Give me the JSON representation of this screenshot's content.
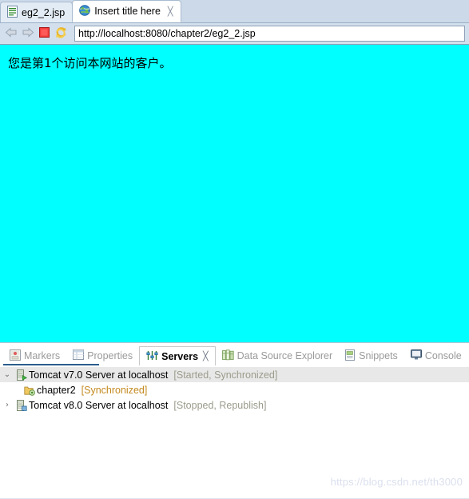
{
  "editor": {
    "tabs": [
      {
        "label": "eg2_2.jsp",
        "icon": "jsp-file-icon",
        "active": false,
        "closable": false
      },
      {
        "label": "Insert title here",
        "icon": "globe-icon",
        "active": true,
        "closable": true,
        "close_glyph": "╳"
      }
    ]
  },
  "toolbar": {
    "back_icon": "back-arrow-icon",
    "forward_icon": "forward-arrow-icon",
    "stop_icon": "stop-icon",
    "refresh_icon": "refresh-icon",
    "url_value": "http://localhost:8080/chapter2/eg2_2.jsp",
    "url_placeholder": "Enter URL"
  },
  "page": {
    "background_color": "#00ffff",
    "text": "您是第1个访问本网站的客户。"
  },
  "views": {
    "tabs": [
      {
        "label": "Markers",
        "icon": "markers-icon",
        "active": false,
        "closable": false
      },
      {
        "label": "Properties",
        "icon": "properties-icon",
        "active": false,
        "closable": false
      },
      {
        "label": "Servers",
        "icon": "servers-icon",
        "active": true,
        "closable": true,
        "close_glyph": "╳"
      },
      {
        "label": "Data Source Explorer",
        "icon": "data-source-explorer-icon",
        "active": false,
        "closable": false
      },
      {
        "label": "Snippets",
        "icon": "snippets-icon",
        "active": false,
        "closable": false
      },
      {
        "label": "Console",
        "icon": "console-icon",
        "active": false,
        "closable": false
      }
    ]
  },
  "servers": {
    "rows": [
      {
        "twisty": "⌄",
        "icon": "server-started-icon",
        "name": "Tomcat v7.0 Server at localhost",
        "state": "[Started, Synchronized]",
        "selected": true,
        "level": 0
      },
      {
        "twisty": "",
        "icon": "module-icon",
        "name": "chapter2",
        "state": "[Synchronized]",
        "selected": false,
        "level": 1
      },
      {
        "twisty": "›",
        "icon": "server-stopped-icon",
        "name": "Tomcat v8.0 Server at localhost",
        "state": "[Stopped, Republish]",
        "selected": false,
        "level": 0
      }
    ]
  },
  "watermark": {
    "text": "https://blog.csdn.net/th3000"
  },
  "colors": {
    "page_background": "#00ffff",
    "tabstrip_background": "#ccd9e8",
    "toolbar_background": "#d3dfec",
    "accent": "#2b5d8c",
    "state_text": "#9b9b8c",
    "sync_text": "#c48a20"
  }
}
